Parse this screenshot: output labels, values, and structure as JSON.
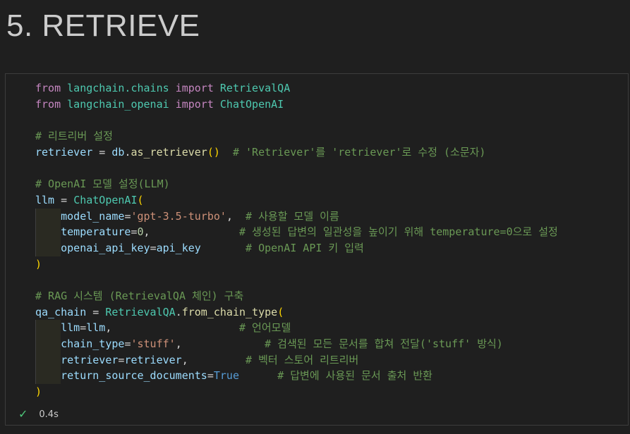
{
  "heading": "5. RETRIEVE",
  "status": {
    "time": "0.4s"
  },
  "colors": {
    "keyword": "#c586c0",
    "module": "#4ec9b0",
    "variable": "#9cdcfe",
    "function": "#dcdcaa",
    "string": "#ce9178",
    "number": "#b5cea8",
    "comment": "#6a9955",
    "boolean": "#569cd6",
    "success": "#4ec97b"
  },
  "code_lines": [
    [
      [
        "kw",
        "from"
      ],
      [
        "op",
        " "
      ],
      [
        "mod",
        "langchain.chains"
      ],
      [
        "op",
        " "
      ],
      [
        "kw",
        "import"
      ],
      [
        "op",
        " "
      ],
      [
        "cls",
        "RetrievalQA"
      ]
    ],
    [
      [
        "kw",
        "from"
      ],
      [
        "op",
        " "
      ],
      [
        "mod",
        "langchain_openai"
      ],
      [
        "op",
        " "
      ],
      [
        "kw",
        "import"
      ],
      [
        "op",
        " "
      ],
      [
        "cls",
        "ChatOpenAI"
      ]
    ],
    [],
    [
      [
        "cmt",
        "# 리트리버 설정"
      ]
    ],
    [
      [
        "var",
        "retriever"
      ],
      [
        "op",
        " = "
      ],
      [
        "var",
        "db"
      ],
      [
        "op",
        "."
      ],
      [
        "fn",
        "as_retriever"
      ],
      [
        "paren",
        "()"
      ],
      [
        "op",
        "  "
      ],
      [
        "cmt",
        "# 'Retriever'를 'retriever'로 수정 (소문자)"
      ]
    ],
    [],
    [
      [
        "cmt",
        "# OpenAI 모델 설정(LLM)"
      ]
    ],
    [
      [
        "var",
        "llm"
      ],
      [
        "op",
        " = "
      ],
      [
        "cls",
        "ChatOpenAI"
      ],
      [
        "paren",
        "("
      ]
    ],
    [
      [
        "op",
        "    "
      ],
      [
        "var",
        "model_name"
      ],
      [
        "op",
        "="
      ],
      [
        "str",
        "'gpt-3.5-turbo'"
      ],
      [
        "op",
        ",  "
      ],
      [
        "cmt",
        "# 사용할 모델 이름"
      ]
    ],
    [
      [
        "op",
        "    "
      ],
      [
        "var",
        "temperature"
      ],
      [
        "op",
        "="
      ],
      [
        "num",
        "0"
      ],
      [
        "op",
        ",              "
      ],
      [
        "cmt",
        "# 생성된 답변의 일관성을 높이기 위해 temperature=0으로 설정"
      ]
    ],
    [
      [
        "op",
        "    "
      ],
      [
        "var",
        "openai_api_key"
      ],
      [
        "op",
        "="
      ],
      [
        "var",
        "api_key"
      ],
      [
        "op",
        "       "
      ],
      [
        "cmt",
        "# OpenAI API 키 입력"
      ]
    ],
    [
      [
        "paren",
        ")"
      ]
    ],
    [],
    [
      [
        "cmt",
        "# RAG 시스템 (RetrievalQA 체인) 구축"
      ]
    ],
    [
      [
        "var",
        "qa_chain"
      ],
      [
        "op",
        " = "
      ],
      [
        "cls",
        "RetrievalQA"
      ],
      [
        "op",
        "."
      ],
      [
        "fn",
        "from_chain_type"
      ],
      [
        "paren",
        "("
      ]
    ],
    [
      [
        "op",
        "    "
      ],
      [
        "var",
        "llm"
      ],
      [
        "op",
        "="
      ],
      [
        "var",
        "llm"
      ],
      [
        "op",
        ",                    "
      ],
      [
        "cmt",
        "# 언어모델"
      ]
    ],
    [
      [
        "op",
        "    "
      ],
      [
        "var",
        "chain_type"
      ],
      [
        "op",
        "="
      ],
      [
        "str",
        "'stuff'"
      ],
      [
        "op",
        ",             "
      ],
      [
        "cmt",
        "# 검색된 모든 문서를 합쳐 전달('stuff' 방식)"
      ]
    ],
    [
      [
        "op",
        "    "
      ],
      [
        "var",
        "retriever"
      ],
      [
        "op",
        "="
      ],
      [
        "var",
        "retriever"
      ],
      [
        "op",
        ",         "
      ],
      [
        "cmt",
        "# 벡터 스토어 리트리버"
      ]
    ],
    [
      [
        "op",
        "    "
      ],
      [
        "var",
        "return_source_documents"
      ],
      [
        "op",
        "="
      ],
      [
        "bool",
        "True"
      ],
      [
        "op",
        "      "
      ],
      [
        "cmt",
        "# 답변에 사용된 문서 출처 반환"
      ]
    ],
    [
      [
        "paren",
        ")"
      ]
    ]
  ]
}
